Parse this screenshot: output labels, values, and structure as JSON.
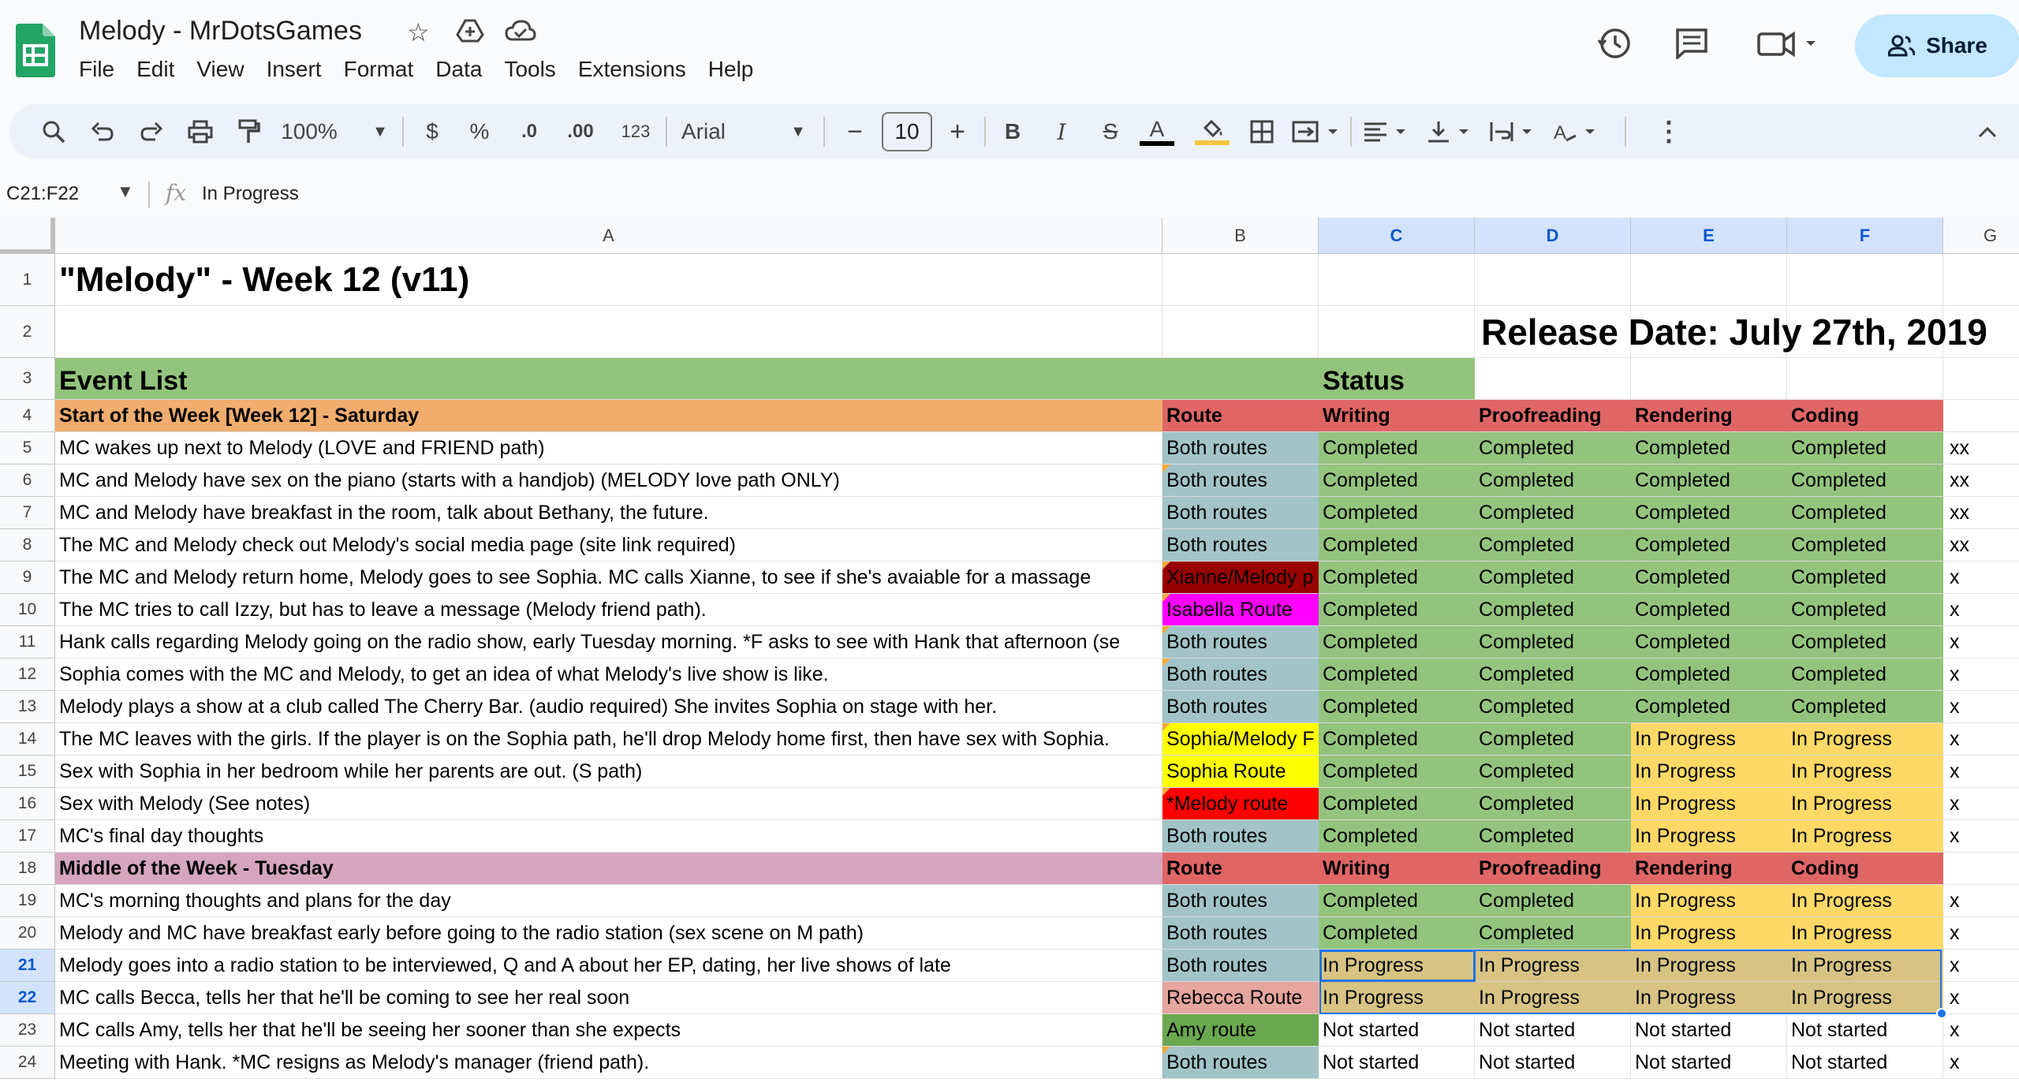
{
  "app": {
    "doc_title": "Melody - MrDotsGames",
    "menu": [
      "File",
      "Edit",
      "View",
      "Insert",
      "Format",
      "Data",
      "Tools",
      "Extensions",
      "Help"
    ],
    "share_label": "Share"
  },
  "toolbar": {
    "zoom": "100%",
    "currency": "$",
    "percent": "%",
    "dec_decrease": ".0",
    "dec_increase": ".00",
    "number_format": "123",
    "font": "Arial",
    "font_size": "10"
  },
  "formula_bar": {
    "name_box": "C21:F22",
    "fx": "fx",
    "value": "In Progress"
  },
  "columns": [
    {
      "letter": "A",
      "selected": false
    },
    {
      "letter": "B",
      "selected": false
    },
    {
      "letter": "C",
      "selected": true
    },
    {
      "letter": "D",
      "selected": true
    },
    {
      "letter": "E",
      "selected": true
    },
    {
      "letter": "F",
      "selected": true
    },
    {
      "letter": "G",
      "selected": false
    }
  ],
  "colors": {
    "green": "#93c47d",
    "orange": "#f0ad6e",
    "red": "#e06666",
    "yellow": "#ffd966",
    "blue_gray": "#a2c4c9",
    "pink": "#d5a6bd",
    "dark_red": "#990000",
    "magenta": "#ff00ff",
    "bright_yellow": "#ffff00",
    "bright_red": "#ff0000",
    "dark_green": "#6aa84f",
    "rebecca": "#e6a59f",
    "sel_yellow": "#e3c87d"
  },
  "rows": [
    {
      "num": "1",
      "cells": [
        "\"Melody\" - Week 12 (v11)",
        "",
        "",
        "",
        "",
        "",
        ""
      ]
    },
    {
      "num": "2",
      "cells": [
        "",
        "",
        "",
        "Release Date: July 27th, 2019",
        "",
        "",
        ""
      ]
    },
    {
      "num": "3",
      "cells": [
        "Event List",
        "",
        "Status",
        "",
        "",
        "",
        ""
      ]
    },
    {
      "num": "4",
      "cells": [
        "Start of the Week  [Week 12] - Saturday",
        "Route",
        "Writing",
        "Proofreading",
        "Rendering",
        "Coding",
        ""
      ]
    },
    {
      "num": "5",
      "cells": [
        "MC wakes up next to Melody (LOVE and FRIEND path)",
        "Both routes",
        "Completed",
        "Completed",
        "Completed",
        "Completed",
        "xx"
      ]
    },
    {
      "num": "6",
      "cells": [
        "MC and Melody have sex on the piano (starts with a handjob) (MELODY love path ONLY)",
        "Both routes",
        "Completed",
        "Completed",
        "Completed",
        "Completed",
        "xx"
      ]
    },
    {
      "num": "7",
      "cells": [
        "MC and Melody have breakfast in the room, talk about Bethany, the future.",
        "Both routes",
        "Completed",
        "Completed",
        "Completed",
        "Completed",
        "xx"
      ]
    },
    {
      "num": "8",
      "cells": [
        "The MC and Melody check out Melody's social media page (site link required)",
        "Both routes",
        "Completed",
        "Completed",
        "Completed",
        "Completed",
        "xx"
      ]
    },
    {
      "num": "9",
      "cells": [
        "The MC and Melody return home, Melody goes to see Sophia. MC calls Xianne, to see if she's avaiable for a massage",
        "Xianne/Melody p",
        "Completed",
        "Completed",
        "Completed",
        "Completed",
        "x"
      ]
    },
    {
      "num": "10",
      "cells": [
        "The MC tries to call Izzy, but has to leave a message (Melody friend path).",
        "Isabella Route",
        "Completed",
        "Completed",
        "Completed",
        "Completed",
        "x"
      ]
    },
    {
      "num": "11",
      "cells": [
        "Hank calls regarding Melody going on the radio show, early Tuesday morning. *F asks to see with Hank that afternoon (se",
        "Both routes",
        "Completed",
        "Completed",
        "Completed",
        "Completed",
        "x"
      ]
    },
    {
      "num": "12",
      "cells": [
        "Sophia comes with the MC and Melody, to get an idea of what Melody's live show is like.",
        "Both routes",
        "Completed",
        "Completed",
        "Completed",
        "Completed",
        "x"
      ]
    },
    {
      "num": "13",
      "cells": [
        "Melody plays a show at a club called The Cherry Bar. (audio required) She invites Sophia on stage with her.",
        "Both routes",
        "Completed",
        "Completed",
        "Completed",
        "Completed",
        "x"
      ]
    },
    {
      "num": "14",
      "cells": [
        "The MC leaves with the girls. If the player is on the Sophia path, he'll drop Melody home first, then have sex with Sophia.",
        "Sophia/Melody F",
        "Completed",
        "Completed",
        "In Progress",
        "In Progress",
        "x"
      ]
    },
    {
      "num": "15",
      "cells": [
        "Sex with Sophia in her bedroom while her parents are out. (S path)",
        "Sophia Route",
        "Completed",
        "Completed",
        "In Progress",
        "In Progress",
        "x"
      ]
    },
    {
      "num": "16",
      "cells": [
        "Sex with Melody (See notes)",
        "*Melody route",
        "Completed",
        "Completed",
        "In Progress",
        "In Progress",
        "x"
      ]
    },
    {
      "num": "17",
      "cells": [
        "MC's final day thoughts",
        "Both routes",
        "Completed",
        "Completed",
        "In Progress",
        "In Progress",
        "x"
      ]
    },
    {
      "num": "18",
      "cells": [
        "Middle of the Week - Tuesday",
        "Route",
        "Writing",
        "Proofreading",
        "Rendering",
        "Coding",
        ""
      ]
    },
    {
      "num": "19",
      "cells": [
        "MC's morning thoughts and plans for the day",
        "Both routes",
        "Completed",
        "Completed",
        "In Progress",
        "In Progress",
        "x"
      ]
    },
    {
      "num": "20",
      "cells": [
        "Melody and MC have breakfast early before going to the radio station (sex scene on M path)",
        "Both routes",
        "Completed",
        "Completed",
        "In Progress",
        "In Progress",
        "x"
      ]
    },
    {
      "num": "21",
      "cells": [
        "Melody goes into a radio station to be interviewed, Q and A about her EP, dating, her live shows of late",
        "Both routes",
        "In Progress",
        "In Progress",
        "In Progress",
        "In Progress",
        "x"
      ]
    },
    {
      "num": "22",
      "cells": [
        "MC calls Becca, tells her that he'll be coming to see her real soon",
        "Rebecca Route",
        "In Progress",
        "In Progress",
        "In Progress",
        "In Progress",
        "x"
      ]
    },
    {
      "num": "23",
      "cells": [
        "MC calls Amy, tells her that he'll be seeing her sooner than she expects",
        "Amy route",
        "Not started",
        "Not started",
        "Not started",
        "Not started",
        "x"
      ]
    },
    {
      "num": "24",
      "cells": [
        "Meeting with Hank. *MC resigns as Melody's manager (friend path).",
        "Both routes",
        "Not started",
        "Not started",
        "Not started",
        "Not started",
        "x"
      ]
    }
  ]
}
